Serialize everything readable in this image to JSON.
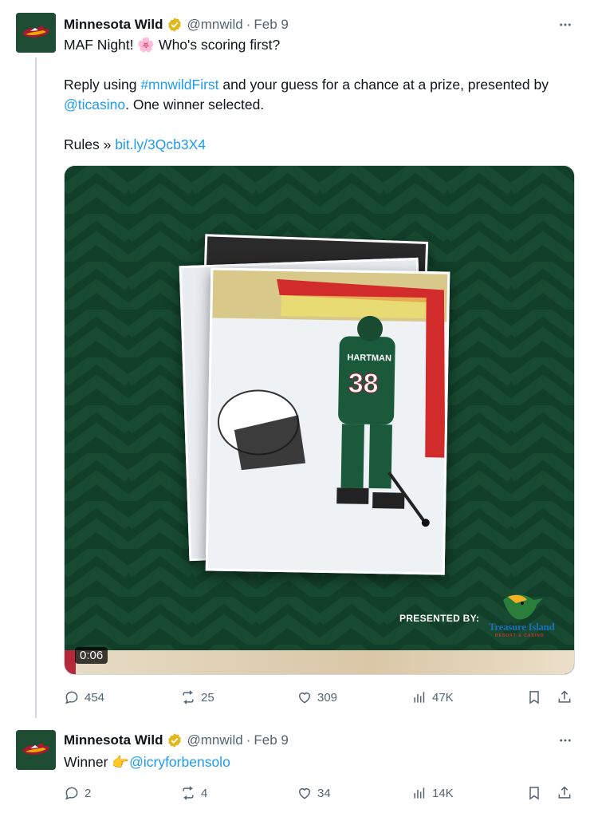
{
  "colors": {
    "accent": "#1d9bf0",
    "muted": "#536471",
    "wild_green": "#154734",
    "wild_red": "#a6192e"
  },
  "tweets": [
    {
      "name": "Minnesota Wild",
      "handle": "@mnwild",
      "separator": "·",
      "date": "Feb 9",
      "line1_before": "MAF Night! ",
      "line1_emoji": "🌸",
      "line1_after": " Who's scoring first?",
      "line2_before": "Reply using ",
      "line2_hashtag": "#mnwildFirst",
      "line2_middle": " and your guess for a chance at a prize, presented by ",
      "line2_mention": "@ticasino",
      "line2_after": ". One winner selected.",
      "line3_before": "Rules » ",
      "line3_link": "bit.ly/3Qcb3X4",
      "media": {
        "timestamp": "0:06",
        "presented_by": "PRESENTED BY:",
        "sponsor": "Treasure Island",
        "sponsor_sub": "RESORT & CASINO",
        "player_name": "HARTMAN",
        "player_number": "38"
      },
      "stats": {
        "replies": "454",
        "reposts": "25",
        "likes": "309",
        "views": "47K"
      }
    },
    {
      "name": "Minnesota Wild",
      "handle": "@mnwild",
      "separator": "·",
      "date": "Feb 9",
      "text_before": "Winner ",
      "emoji": "👉",
      "mention": "@icryforbensolo",
      "stats": {
        "replies": "2",
        "reposts": "4",
        "likes": "34",
        "views": "14K"
      }
    }
  ]
}
